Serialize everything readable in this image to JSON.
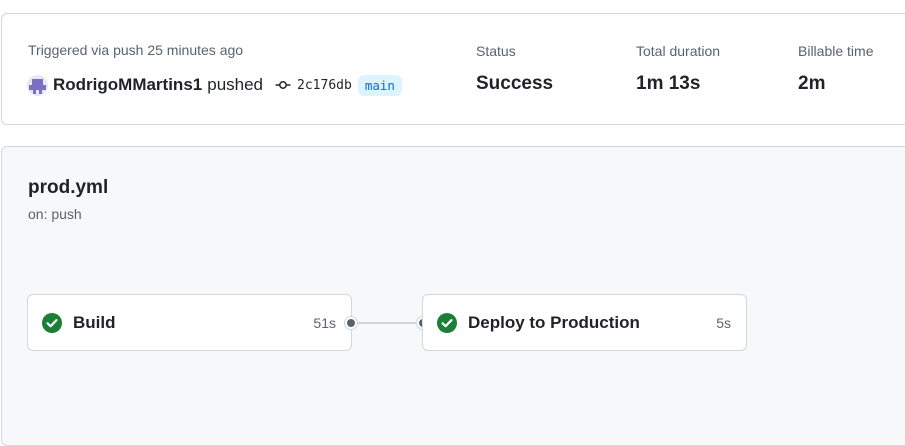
{
  "run_summary": {
    "trigger_text": "Triggered via push 25 minutes ago",
    "actor": "RodrigoMMartins1",
    "action": "pushed",
    "commit_sha": "2c176db",
    "branch": "main",
    "status_label": "Status",
    "status_value": "Success",
    "duration_label": "Total duration",
    "duration_value": "1m 13s",
    "billable_label": "Billable time",
    "billable_value": "2m",
    "icons": {
      "avatar": "user-avatar",
      "commit": "git-commit-icon"
    }
  },
  "workflow": {
    "file": "prod.yml",
    "event": "on: push",
    "jobs": [
      {
        "name": "Build",
        "duration": "51s",
        "status": "success",
        "icon": "check-circle-icon"
      },
      {
        "name": "Deploy to Production",
        "duration": "5s",
        "status": "success",
        "icon": "check-circle-icon"
      }
    ]
  },
  "colors": {
    "success": "#1a7f37",
    "branch_bg": "#ddf4ff",
    "branch_text": "#0969da",
    "muted_text": "#59636e",
    "border": "#d0d7de"
  }
}
